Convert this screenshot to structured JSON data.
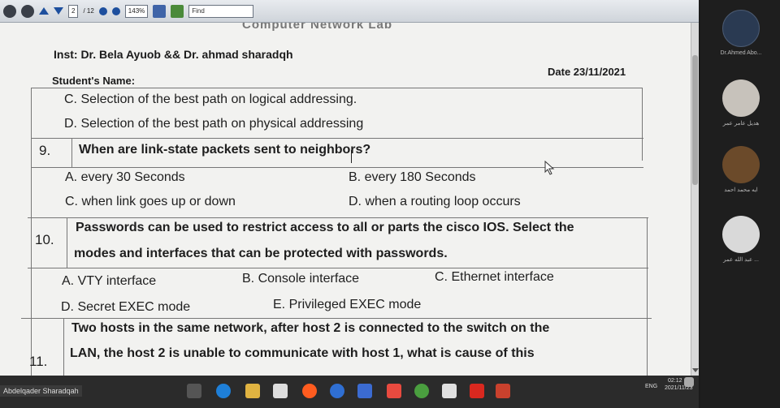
{
  "toolbar": {
    "page_current": "2",
    "page_total": "/ 12",
    "zoom": "143%",
    "find_placeholder": "Find"
  },
  "document": {
    "cut_header": "Computer Network Lab",
    "instructors": "Inst: Dr. Bela Ayuob && Dr. ahmad sharadqh",
    "date": "Date 23/11/2021",
    "student_label": "Student's Name:",
    "q8_option_c": "C. Selection of the best path on logical addressing.",
    "q8_option_d": "D. Selection of the best path on physical addressing",
    "q9": {
      "number": "9.",
      "question": "When are link-state packets sent to neighbors?",
      "option_a": "A. every 30 Seconds",
      "option_b": "B. every 180 Seconds",
      "option_c": "C. when link goes up or down",
      "option_d": "D. when a routing loop occurs"
    },
    "q10": {
      "number": "10.",
      "question_line1": "Passwords can be used to restrict access to all or parts the cisco IOS. Select the",
      "question_line2": "modes and interfaces that can be protected with passwords.",
      "option_a": "A. VTY interface",
      "option_b": "B. Console interface",
      "option_c": "C. Ethernet interface",
      "option_d": "D. Secret EXEC mode",
      "option_e": "E. Privileged EXEC mode"
    },
    "q11": {
      "number": "11.",
      "question_line1": "Two hosts in the same network, after host 2 is connected to the switch on the",
      "question_line2": "LAN, the host 2 is unable to communicate with host 1, what is cause of this"
    }
  },
  "participants": [
    {
      "name": "Dr.Ahmed Abo...",
      "color": "#2a3a52"
    },
    {
      "name": "هديل عامر عمر",
      "color": "#c7c2bb"
    },
    {
      "name": "ايه محمد احمد",
      "color": "#6b4a2a"
    },
    {
      "name": "عبد الله عمر ...",
      "color": "#d9d9d9"
    }
  ],
  "taskbar": {
    "user": "Abdelqader Sharadqah",
    "lang": "ENG",
    "time": "02:12 م",
    "date": "2021/11/23"
  },
  "colors": {
    "toolbar_bg": "#d9dde2",
    "page_bg": "#f2f2f0",
    "panel_bg": "#1e1e1e",
    "taskbar_bg": "#2b2b2b"
  }
}
